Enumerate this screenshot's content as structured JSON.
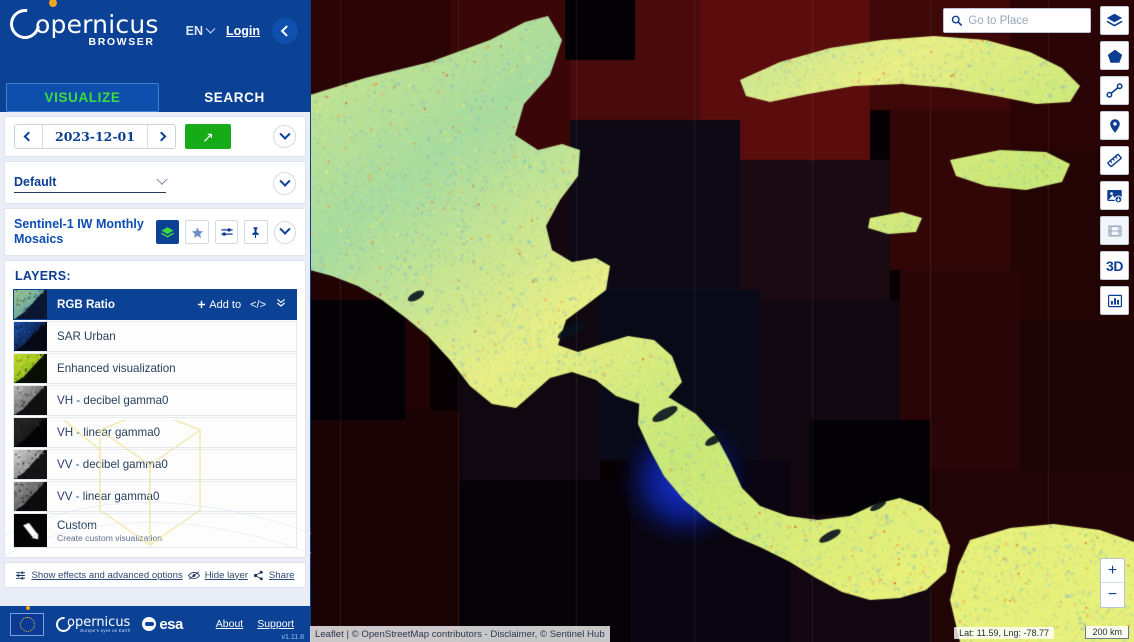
{
  "app": {
    "brand": "opernicus",
    "brand_sub": "BROWSER",
    "logo_icon": "copernicus-c-icon"
  },
  "header": {
    "language": "EN",
    "login_label": "Login",
    "collapse_icon": "chevron-left-icon",
    "lang_chevron_icon": "chevron-down-icon"
  },
  "tabs": [
    {
      "label": "VISUALIZE",
      "active": true
    },
    {
      "label": "SEARCH",
      "active": false
    }
  ],
  "date_bar": {
    "prev_icon": "chevron-left-icon",
    "next_icon": "chevron-right-icon",
    "date": "2023-12-01",
    "apply_icon": "arrow-up-right-icon",
    "expand_icon": "chevron-down-circle-icon"
  },
  "theme_select": {
    "value": "Default",
    "chevron_icon": "chevron-down-icon",
    "expand_icon": "chevron-down-circle-icon"
  },
  "source": {
    "title": "Sentinel-1 IW Monthly Mosaics",
    "buttons": [
      {
        "name": "layers-stack-icon",
        "active": true
      },
      {
        "name": "star-icon",
        "active": false
      },
      {
        "name": "sliders-icon",
        "active": false
      },
      {
        "name": "pin-icon",
        "active": false
      }
    ],
    "expand_icon": "chevron-down-circle-icon"
  },
  "layers": {
    "title": "LAYERS:",
    "active_actions": {
      "add_to_label": "Add to",
      "add_icon": "plus-icon",
      "code_label": "</>",
      "expand_icon": "double-chevron-down-icon"
    },
    "items": [
      {
        "label": "RGB Ratio",
        "sub": "",
        "active": true,
        "thumb": [
          "#9fc48a",
          "#67a9a0",
          "#0b1730",
          "#e2d98a"
        ]
      },
      {
        "label": "SAR Urban",
        "sub": "",
        "active": false,
        "thumb": [
          "#1b4fa8",
          "#0c2553",
          "#050a16",
          "#2e6fd0"
        ]
      },
      {
        "label": "Enhanced visualization",
        "sub": "",
        "active": false,
        "thumb": [
          "#c4d92a",
          "#8fbd1b",
          "#0a0f06",
          "#e8e84a"
        ]
      },
      {
        "label": "VH - decibel gamma0",
        "sub": "",
        "active": false,
        "thumb": [
          "#b7b7b7",
          "#6e6e6e",
          "#111111",
          "#d2d2d2"
        ]
      },
      {
        "label": "VH - linear gamma0",
        "sub": "",
        "active": false,
        "thumb": [
          "#2a2a2a",
          "#171717",
          "#050505",
          "#3a3a3a"
        ]
      },
      {
        "label": "VV - decibel gamma0",
        "sub": "",
        "active": false,
        "thumb": [
          "#cfcfcf",
          "#8c8c8c",
          "#151515",
          "#e3e3e3"
        ]
      },
      {
        "label": "VV - linear gamma0",
        "sub": "",
        "active": false,
        "thumb": [
          "#9a9a9a",
          "#5e5e5e",
          "#0d0d0d",
          "#bdbdbd"
        ]
      },
      {
        "label": "Custom",
        "sub": "Create custom visualization",
        "active": false,
        "thumb": [
          "#1a1a1a",
          "#101010",
          "#050505",
          "#262626"
        ],
        "icon": "brush-icon"
      }
    ]
  },
  "effects_bar": [
    {
      "label": "Show effects and advanced options",
      "icon": "effects-sliders-icon"
    },
    {
      "label": "Hide layer",
      "icon": "eye-slash-icon"
    },
    {
      "label": "Share",
      "icon": "share-icon"
    }
  ],
  "footer": {
    "eu_flag_icon": "eu-flag-icon",
    "copernicus_label": "opernicus",
    "copernicus_tagline": "Europe's eyes on Earth",
    "esa_label": "esa",
    "links": [
      {
        "label": "About"
      },
      {
        "label": "Support"
      }
    ],
    "version": "v1.11.8"
  },
  "map": {
    "search": {
      "placeholder": "Go to Place",
      "value": "",
      "icon": "search-icon"
    },
    "toolbar": [
      {
        "name": "layers-icon",
        "glyph": "layers",
        "dim": false
      },
      {
        "name": "polygon-icon",
        "glyph": "pentagon",
        "dim": false
      },
      {
        "name": "line-measure-icon",
        "glyph": "line",
        "dim": false
      },
      {
        "name": "marker-pin-icon",
        "glyph": "pin",
        "dim": false
      },
      {
        "name": "ruler-icon",
        "glyph": "ruler",
        "dim": false
      },
      {
        "name": "image-download-icon",
        "glyph": "image",
        "dim": false
      },
      {
        "name": "timelapse-icon",
        "glyph": "film",
        "dim": true
      },
      {
        "name": "3d-view-button",
        "glyph": "3D",
        "dim": false
      },
      {
        "name": "statistics-icon",
        "glyph": "chart",
        "dim": false
      }
    ],
    "zoom_in": "+",
    "zoom_out": "−",
    "attribution": "Leaflet | © OpenStreetMap contributors - Disclaimer, © Sentinel Hub",
    "coordinates": "Lat: 11.59, Lng: -78.77",
    "scale": "200 km"
  }
}
